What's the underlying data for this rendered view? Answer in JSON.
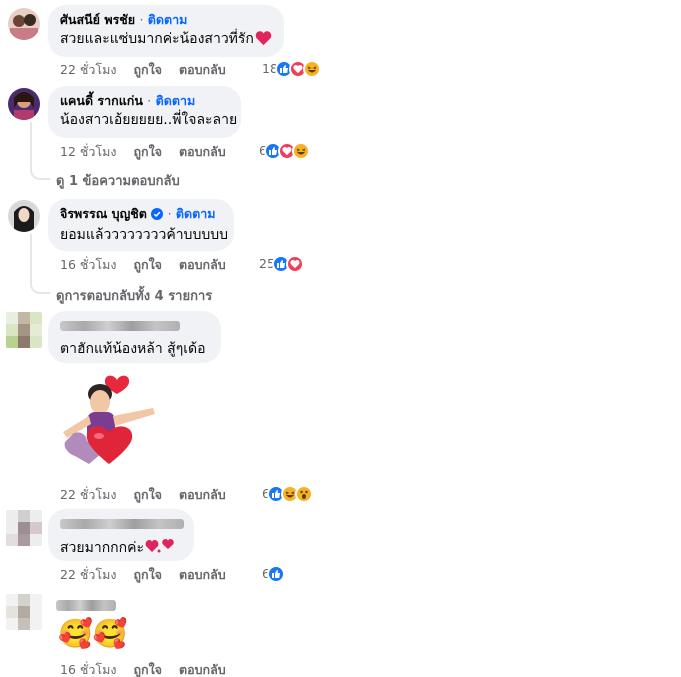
{
  "comments": [
    {
      "name": "ศันสนีย์ พรชัย",
      "follow": "ติดตาม",
      "text": "สวยและแซ่บมากค่ะน้องสาวที่รัก",
      "time": "22 ชั่วโมง",
      "like": "ถูกใจ",
      "reply": "ตอบกลับ",
      "reaction_count": "18",
      "reactions": [
        "like",
        "love",
        "haha"
      ]
    },
    {
      "name": "แคนดี้ รากแก่น",
      "follow": "ติดตาม",
      "text": "น้องสาวเอ้ยยยยย..พี่ใจละลาย",
      "time": "12 ชั่วโมง",
      "like": "ถูกใจ",
      "reply": "ตอบกลับ",
      "reaction_count": "6",
      "reactions": [
        "like",
        "love",
        "haha"
      ],
      "view_replies": "ดู 1 ข้อความตอบกลับ"
    },
    {
      "name": "จิรพรรณ บุญชิต",
      "follow": "ติดตาม",
      "text": "ยอมแล้ววววววววค้าบบบบบ",
      "time": "16 ชั่วโมง",
      "like": "ถูกใจ",
      "reply": "ตอบกลับ",
      "reaction_count": "25",
      "reactions": [
        "like",
        "love"
      ],
      "view_replies": "ดูการตอบกลับทั้ง 4 รายการ"
    },
    {
      "text": "ตาฮักแท้น้องหล้า สู้ๆเด้อ",
      "time": "22 ชั่วโมง",
      "like": "ถูกใจ",
      "reply": "ตอบกลับ",
      "reaction_count": "6",
      "reactions": [
        "like",
        "haha",
        "wow"
      ]
    },
    {
      "text": "สวยมากกกค่ะ",
      "time": "22 ชั่วโมง",
      "like": "ถูกใจ",
      "reply": "ตอบกลับ",
      "reaction_count": "6",
      "reactions": [
        "like"
      ]
    },
    {
      "text": "🥰🥰",
      "time": "16 ชั่วโมง",
      "like": "ถูกใจ",
      "reply": "ตอบกลับ"
    }
  ],
  "colors": {
    "accent": "#0866ff",
    "like": "#1877f2",
    "love": "#f33e58",
    "haha": "#f7b125",
    "bubble": "#f0f2f5",
    "muted": "#65676b"
  },
  "icons": {
    "verified": "verified-badge-icon",
    "heart": "red-heart-icon",
    "sticker": "avatar-hug-hearts-sticker"
  }
}
